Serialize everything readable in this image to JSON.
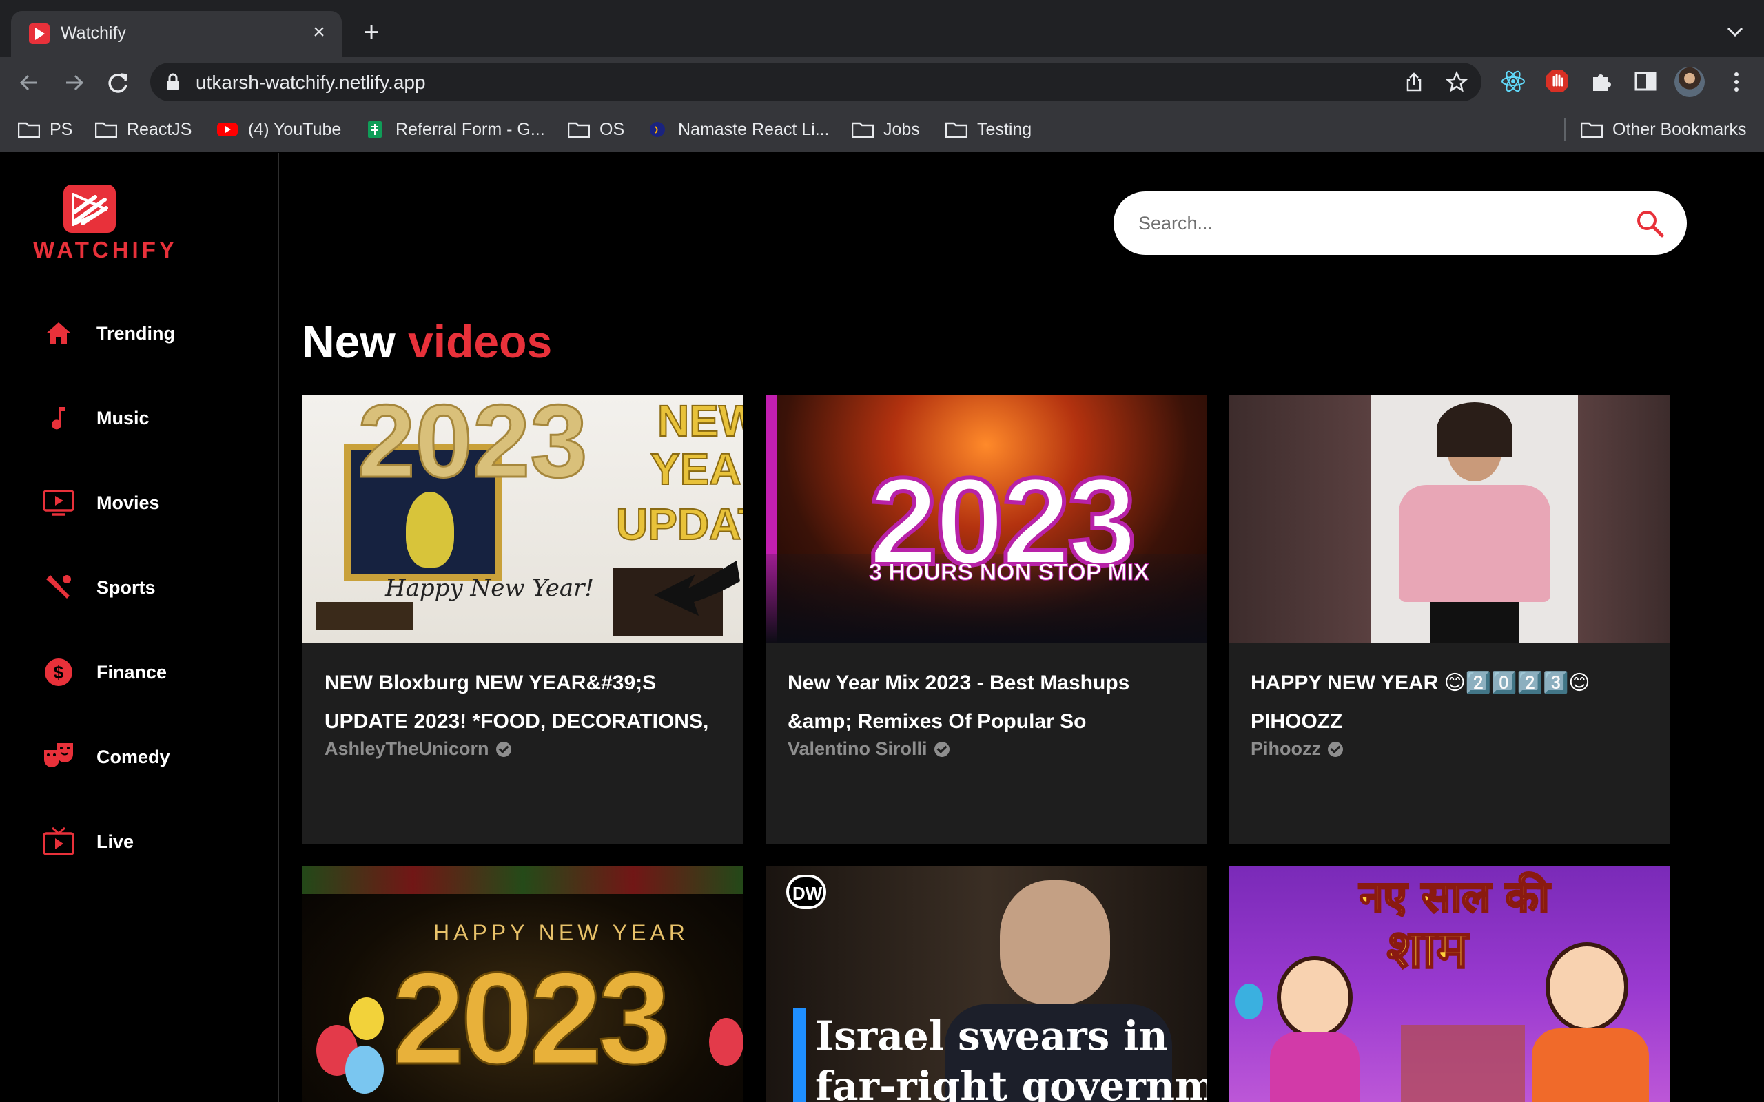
{
  "browser": {
    "tab_title": "Watchify",
    "url": "utkarsh-watchify.netlify.app",
    "bookmarks": [
      {
        "label": "PS"
      },
      {
        "label": "ReactJS"
      },
      {
        "label": "(4) YouTube"
      },
      {
        "label": "Referral Form - G..."
      },
      {
        "label": "OS"
      },
      {
        "label": "Namaste React Li..."
      },
      {
        "label": "Jobs"
      },
      {
        "label": "Testing"
      }
    ],
    "other_bookmarks": "Other Bookmarks"
  },
  "app": {
    "logo_text": "WATCHIFY",
    "search": {
      "placeholder": "Search..."
    },
    "sidebar": {
      "items": [
        {
          "label": "Trending",
          "icon": "home-icon"
        },
        {
          "label": "Music",
          "icon": "music-note-icon"
        },
        {
          "label": "Movies",
          "icon": "tv-play-icon"
        },
        {
          "label": "Sports",
          "icon": "sports-icon"
        },
        {
          "label": "Finance",
          "icon": "dollar-icon"
        },
        {
          "label": "Comedy",
          "icon": "theater-masks-icon"
        },
        {
          "label": "Live",
          "icon": "live-tv-icon"
        }
      ]
    },
    "feed": {
      "title_plain": "New",
      "title_accent": "videos",
      "videos": [
        {
          "title": "NEW Bloxburg NEW YEAR&#39;S UPDATE 2023! *FOOD, DECORATIONS,",
          "channel": "AshleyTheUnicorn",
          "thumb_text": [
            "2023",
            "NEW",
            "YEAR",
            "UPDAT",
            "Happy New Year!"
          ]
        },
        {
          "title": "New Year Mix 2023 - Best Mashups &amp; Remixes Of Popular So",
          "channel": "Valentino Sirolli",
          "thumb_text": [
            "2023",
            "3 HOURS NON STOP MIX"
          ]
        },
        {
          "title": "HAPPY NEW YEAR 😊2️⃣0️⃣2️⃣3️⃣😊 PIHOOZZ",
          "channel": "Pihoozz",
          "thumb_text": []
        },
        {
          "title": "",
          "channel": "",
          "thumb_text": [
            "HAPPY NEW YEAR",
            "2023"
          ]
        },
        {
          "title": "",
          "channel": "",
          "thumb_text": [
            "DW",
            "Israel swears in",
            "far-right governme"
          ]
        },
        {
          "title": "",
          "channel": "",
          "thumb_text": [
            "नए साल की",
            "शाम"
          ]
        }
      ]
    },
    "colors": {
      "accent": "#e8313a",
      "card_bg": "#1e1e1e",
      "page_bg": "#000000"
    }
  }
}
